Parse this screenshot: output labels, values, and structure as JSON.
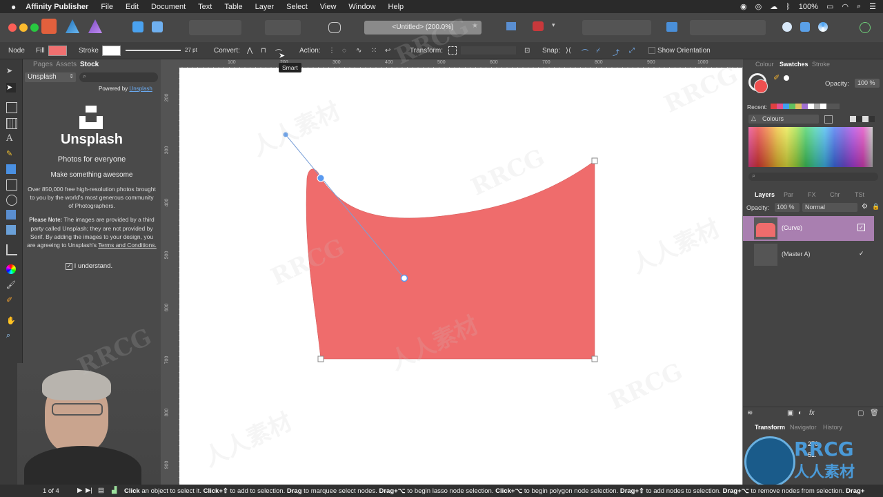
{
  "menubar": {
    "app_name": "Affinity Publisher",
    "items": [
      "File",
      "Edit",
      "Document",
      "Text",
      "Table",
      "Layer",
      "Select",
      "View",
      "Window",
      "Help"
    ],
    "battery": "100%"
  },
  "toolbar": {
    "document_title": "<Untitled> (200.0%)"
  },
  "context": {
    "node_label": "Node",
    "fill_label": "Fill",
    "fill_color": "#f07070",
    "stroke_label": "Stroke",
    "stroke_width": "27 pt",
    "convert_label": "Convert:",
    "action_label": "Action:",
    "transform_label": "Transform:",
    "snap_label": "Snap:",
    "show_orientation": "Show Orientation",
    "tooltip": "Smart"
  },
  "stock_panel": {
    "tabs": [
      "Pages",
      "Assets",
      "Stock"
    ],
    "active_tab": "Stock",
    "source": "Unsplash",
    "powered_by": "Powered by",
    "powered_link": "Unsplash",
    "brand": "Unsplash",
    "tagline": "Photos for everyone",
    "slogan": "Make something awesome",
    "description": "Over 850,000 free high-resolution photos brought to you by the world's most generous community of Photographers.",
    "note_bold": "Please Note:",
    "note_text": "The images are provided by a third party called Unsplash; they are not provided by Serif. By adding the images to your design, you are agreeing to Unsplash's",
    "terms_link": "Terms and Conditions.",
    "understand": "I understand.",
    "understand_checked": true
  },
  "ruler": {
    "unit": "px",
    "h_ticks": [
      "100",
      "200",
      "300",
      "400",
      "500",
      "600",
      "700",
      "800",
      "900",
      "1000"
    ],
    "v_ticks": [
      "200",
      "300",
      "400",
      "500",
      "600",
      "700",
      "800",
      "900"
    ]
  },
  "right_panel": {
    "top_tabs": [
      "Colour",
      "Swatches",
      "Stroke"
    ],
    "active_top_tab": "Swatches",
    "opacity_label": "Opacity:",
    "opacity_value": "100 %",
    "recent_label": "Recent:",
    "palette_name": "Colours",
    "layer_tabs": [
      "Layers",
      "Par",
      "FX",
      "Chr",
      "TSt"
    ],
    "active_layer_tab": "Layers",
    "layer_opacity_label": "Opacity:",
    "layer_opacity_value": "100 %",
    "blend_mode": "Normal",
    "layers": [
      {
        "name": "(Curve)",
        "selected": true
      },
      {
        "name": "(Master A)",
        "selected": false
      }
    ],
    "bottom_tabs": [
      "Transform",
      "Navigator",
      "History"
    ],
    "active_bottom_tab": "Transform",
    "transform_x": "270",
    "transform_y": "51."
  },
  "status": {
    "pages": "1 of 4",
    "hint_parts": [
      {
        "b": "Click",
        "t": " an object to select it. "
      },
      {
        "b": "Click+⇧",
        "t": " to add to selection. "
      },
      {
        "b": "Drag",
        "t": " to marquee select nodes. "
      },
      {
        "b": "Drag+⌥",
        "t": " to begin lasso node selection. "
      },
      {
        "b": "Click+⌥",
        "t": " to begin polygon node selection. "
      },
      {
        "b": "Drag+⇧",
        "t": " to add nodes to selection. "
      },
      {
        "b": "Drag+⌥",
        "t": " to remove nodes from selection. "
      },
      {
        "b": "Drag+",
        "t": ""
      }
    ]
  },
  "watermark": {
    "text_latin": "RRCG",
    "text_cn": "人人素材"
  }
}
